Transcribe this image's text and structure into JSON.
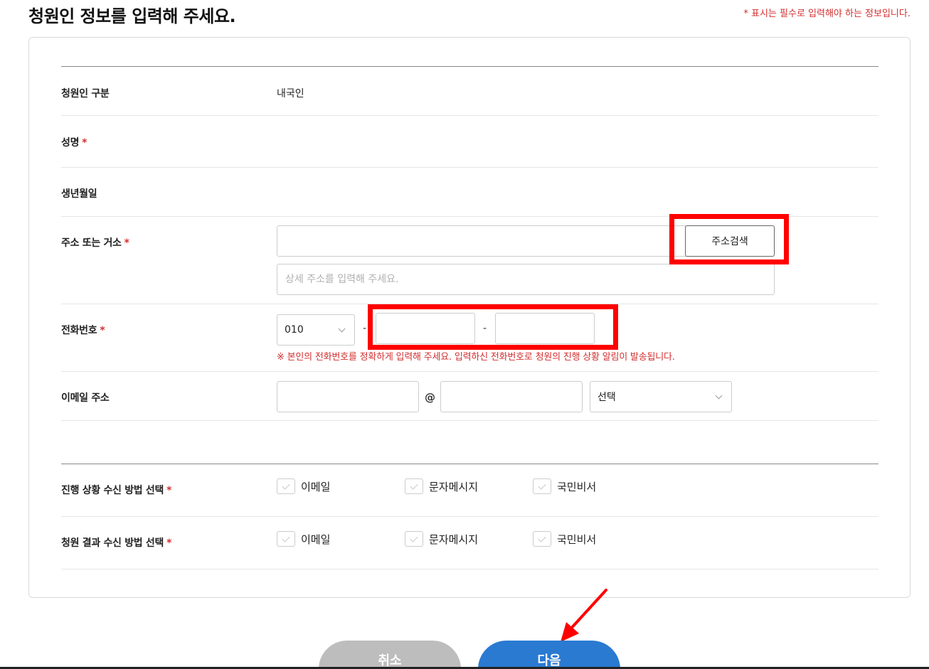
{
  "header": {
    "title": "청원인 정보를 입력해 주세요.",
    "required_note": "* 표시는 필수로 입력해야 하는 정보입니다."
  },
  "fields": {
    "petitioner_type": {
      "label": "청원인 구분",
      "value": "내국인"
    },
    "name": {
      "label": "성명",
      "required_mark": "*"
    },
    "birthdate": {
      "label": "생년월일"
    },
    "address": {
      "label": "주소 또는 거소",
      "required_mark": "*",
      "main_value": "",
      "search_button": "주소검색",
      "detail_placeholder": "상세 주소를 입력해 주세요.",
      "detail_value": ""
    },
    "phone": {
      "label": "전화번호",
      "required_mark": "*",
      "prefix_selected": "010",
      "dash": "-",
      "middle_value": "",
      "last_value": "",
      "hint": "※ 본인의 전화번호를 정확하게 입력해 주세요. 입력하신 전화번호로 청원의 진행 상황 알림이 발송됩니다."
    },
    "email": {
      "label": "이메일 주소",
      "local_value": "",
      "at": "@",
      "domain_value": "",
      "domain_select": "선택"
    }
  },
  "notifications": {
    "progress": {
      "label": "진행 상황 수신 방법 선택",
      "required_mark": "*",
      "options": [
        "이메일",
        "문자메시지",
        "국민비서"
      ]
    },
    "result": {
      "label": "청원 결과 수신 방법 선택",
      "required_mark": "*",
      "options": [
        "이메일",
        "문자메시지",
        "국민비서"
      ]
    }
  },
  "actions": {
    "cancel_label": "취소",
    "next_label": "다음"
  },
  "colors": {
    "accent_blue": "#2a7ad2",
    "required_red": "#d32f2f",
    "highlight_red": "#ff0000",
    "cancel_gray": "#bdbdbd"
  }
}
